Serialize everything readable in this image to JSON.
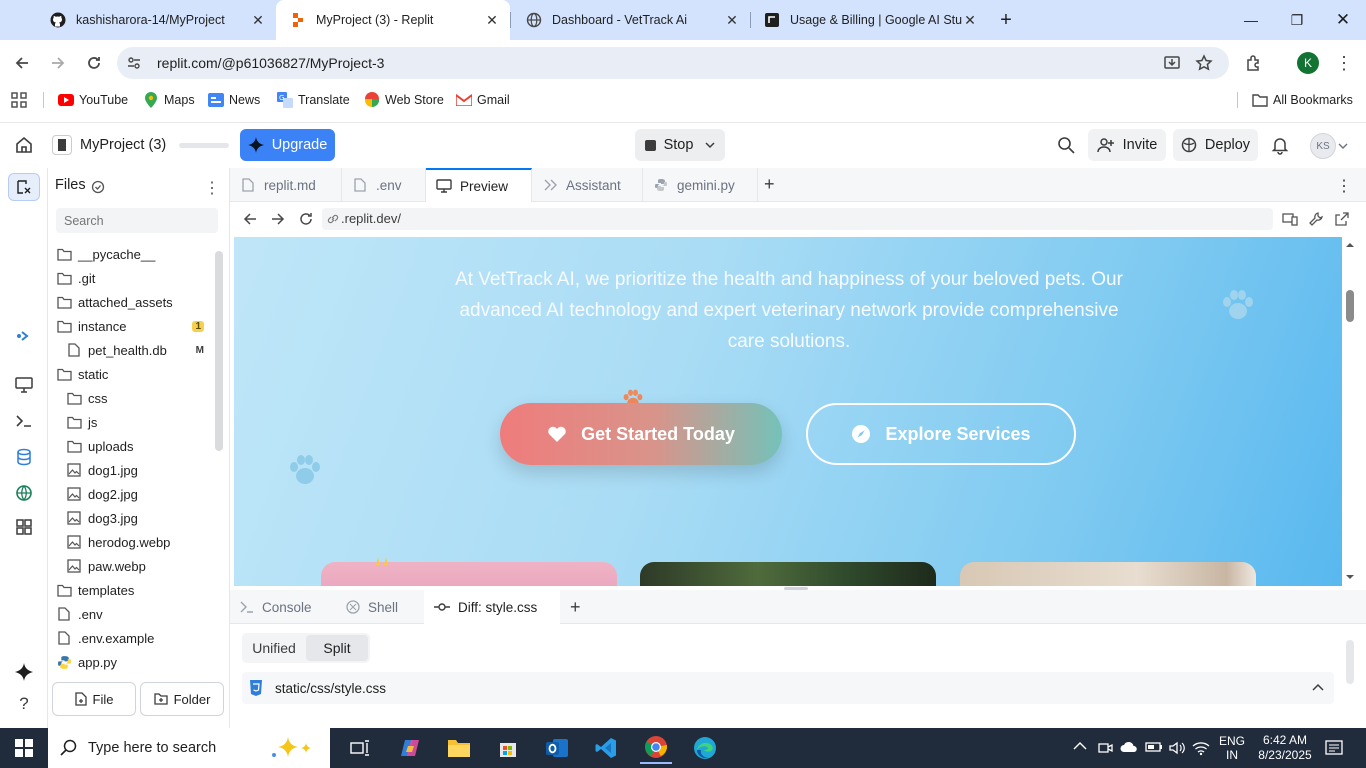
{
  "browser": {
    "tabs": [
      {
        "title": "kashisharora-14/MyProject",
        "icon": "github-icon"
      },
      {
        "title": "MyProject (3) - Replit",
        "icon": "replit-icon",
        "active": true
      },
      {
        "title": "Dashboard - VetTrack Ai",
        "icon": "globe-icon"
      },
      {
        "title": "Usage & Billing | Google AI Stu",
        "icon": "ai-studio-icon"
      }
    ],
    "url": "replit.com/@p61036827/MyProject-3",
    "profile_initial": "K",
    "bookmarks": [
      {
        "label": "YouTube",
        "icon": "youtube-icon"
      },
      {
        "label": "Maps",
        "icon": "maps-icon"
      },
      {
        "label": "News",
        "icon": "news-icon"
      },
      {
        "label": "Translate",
        "icon": "translate-icon"
      },
      {
        "label": "Web Store",
        "icon": "webstore-icon"
      },
      {
        "label": "Gmail",
        "icon": "gmail-icon"
      }
    ],
    "all_bookmarks": "All Bookmarks"
  },
  "replit": {
    "project_name": "MyProject (3)",
    "upgrade": "Upgrade",
    "stop": "Stop",
    "invite": "Invite",
    "deploy": "Deploy",
    "avatar": "KS",
    "files_title": "Files",
    "search_placeholder": "Search",
    "file_tree": [
      {
        "name": "__pycache__",
        "type": "folder",
        "depth": 0
      },
      {
        "name": ".git",
        "type": "folder",
        "depth": 0
      },
      {
        "name": "attached_assets",
        "type": "folder",
        "depth": 0
      },
      {
        "name": "instance",
        "type": "folder",
        "depth": 0,
        "badge": "1"
      },
      {
        "name": "pet_health.db",
        "type": "file",
        "depth": 1,
        "badge": "M"
      },
      {
        "name": "static",
        "type": "folder",
        "depth": 0
      },
      {
        "name": "css",
        "type": "folder",
        "depth": 1
      },
      {
        "name": "js",
        "type": "folder",
        "depth": 1
      },
      {
        "name": "uploads",
        "type": "folder",
        "depth": 1
      },
      {
        "name": "dog1.jpg",
        "type": "image",
        "depth": 1
      },
      {
        "name": "dog2.jpg",
        "type": "image",
        "depth": 1
      },
      {
        "name": "dog3.jpg",
        "type": "image",
        "depth": 1
      },
      {
        "name": "herodog.webp",
        "type": "image",
        "depth": 1
      },
      {
        "name": "paw.webp",
        "type": "image",
        "depth": 1
      },
      {
        "name": "templates",
        "type": "folder",
        "depth": 0
      },
      {
        "name": ".env",
        "type": "file",
        "depth": 0
      },
      {
        "name": ".env.example",
        "type": "file",
        "depth": 0
      },
      {
        "name": "app.py",
        "type": "python",
        "depth": 0
      }
    ],
    "new_file": "File",
    "new_folder": "Folder",
    "editor_tabs": [
      {
        "label": "replit.md",
        "icon": "file-icon"
      },
      {
        "label": ".env",
        "icon": "file-icon"
      },
      {
        "label": "Preview",
        "icon": "monitor-icon",
        "active": true
      },
      {
        "label": "Assistant",
        "icon": "assistant-icon"
      },
      {
        "label": "gemini.py",
        "icon": "python-icon"
      }
    ],
    "preview_url": ".replit.dev/",
    "preview": {
      "hero_text": "At VetTrack AI, we prioritize the health and happiness of your beloved pets. Our advanced AI technology and expert veterinary network provide comprehensive care solutions.",
      "primary_button": "Get Started Today",
      "secondary_button": "Explore Services"
    },
    "bottom_tabs": [
      {
        "label": "Console",
        "icon": "console-icon"
      },
      {
        "label": "Shell",
        "icon": "shell-icon"
      },
      {
        "label": "Diff: style.css",
        "icon": "diff-icon",
        "active": true
      }
    ],
    "diff_modes": [
      "Unified",
      "Split"
    ],
    "diff_file": "static/css/style.css"
  },
  "taskbar": {
    "search_placeholder": "Type here to search",
    "lang": "ENG",
    "region": "IN",
    "time": "6:42 AM",
    "date": "8/23/2025"
  }
}
